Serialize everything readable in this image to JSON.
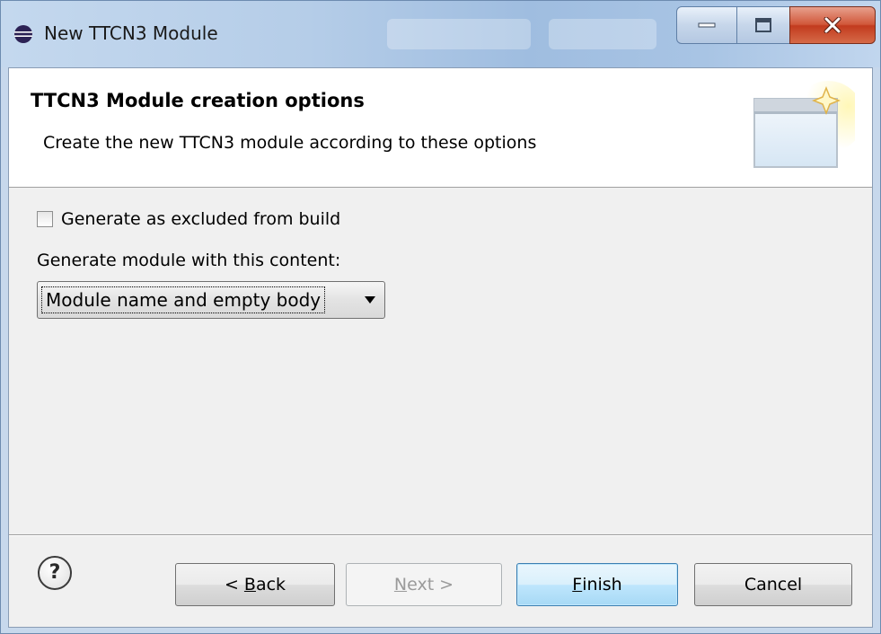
{
  "window": {
    "title": "New TTCN3 Module"
  },
  "header": {
    "title": "TTCN3 Module creation options",
    "description": "Create the new TTCN3 module according to these options"
  },
  "options": {
    "exclude_checkbox": {
      "label": "Generate as excluded from build",
      "checked": false
    },
    "content_label": "Generate module with this content:",
    "content_select": {
      "selected": "Module name and empty body"
    }
  },
  "buttons": {
    "help_glyph": "?",
    "back": {
      "prefix": "< ",
      "mnemonic": "B",
      "rest": "ack",
      "enabled": true
    },
    "next": {
      "mnemonic": "N",
      "rest": "ext >",
      "enabled": false
    },
    "finish": {
      "mnemonic": "F",
      "rest": "inish",
      "enabled": true,
      "default": true
    },
    "cancel": {
      "label": "Cancel",
      "enabled": true
    }
  },
  "icons": {
    "app": "eclipse-icon",
    "wizard_banner": "new-file-wizard-icon",
    "help": "help-icon",
    "dropdown": "chevron-down-icon"
  },
  "colors": {
    "titlebar": "#b5cde8",
    "client_background": "#f0f0f0",
    "header_background": "#ffffff",
    "close_button": "#c23b1e",
    "default_button_border": "#3c7fb1"
  }
}
